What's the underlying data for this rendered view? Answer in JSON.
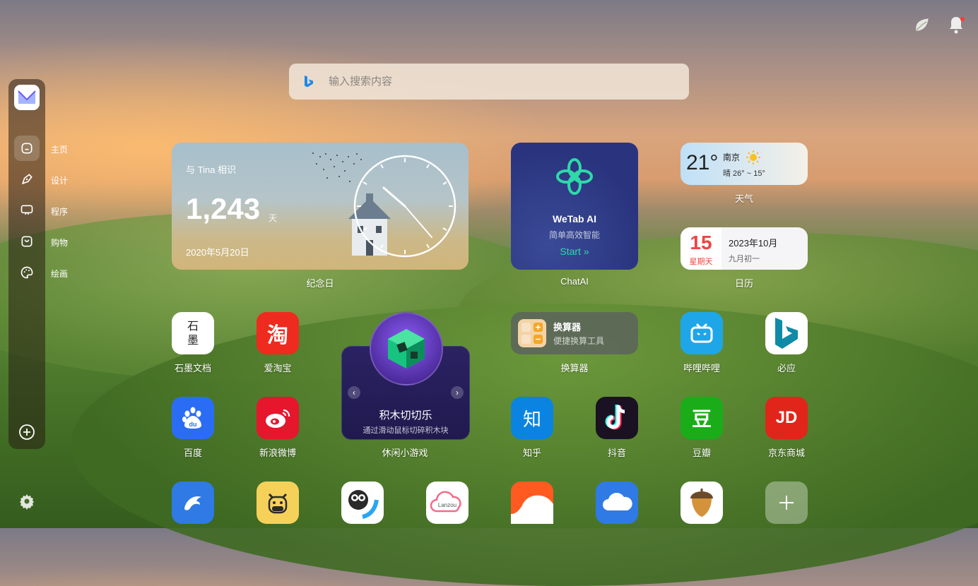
{
  "search": {
    "placeholder": "输入搜索内容"
  },
  "sidebar": {
    "items": [
      {
        "label": "主页",
        "icon": "home-icon"
      },
      {
        "label": "设计",
        "icon": "pen-icon"
      },
      {
        "label": "程序",
        "icon": "code-icon"
      },
      {
        "label": "购物",
        "icon": "bag-icon"
      },
      {
        "label": "绘画",
        "icon": "palette-icon"
      }
    ]
  },
  "widgets": {
    "anniversary": {
      "title": "与 Tina 相识",
      "count": "1,243",
      "unit": "天",
      "date": "2020年5月20日",
      "caption": "纪念日"
    },
    "chatai": {
      "title": "WeTab AI",
      "subtitle": "简单高效智能",
      "start": "Start »",
      "caption": "ChatAI"
    },
    "weather": {
      "temp": "21°",
      "city": "南京",
      "range": "晴 26° ~ 15°",
      "caption": "天气"
    },
    "calendar": {
      "day": "15",
      "weekday": "星期天",
      "year_month": "2023年10月",
      "lunar": "九月初一",
      "caption": "日历"
    },
    "converter": {
      "title": "换算器",
      "subtitle": "便捷换算工具",
      "caption": "换算器"
    },
    "game": {
      "title": "积木切切乐",
      "subtitle": "通过滑动鼠标切碎积木块",
      "caption": "休闲小游戏"
    }
  },
  "apps": {
    "shimo": {
      "label": "石墨文档",
      "glyph": "石墨"
    },
    "taobao": {
      "label": "爱淘宝",
      "glyph": "淘"
    },
    "bilibili": {
      "label": "哔哩哔哩"
    },
    "bing": {
      "label": "必应"
    },
    "baidu": {
      "label": "百度",
      "glyph": "du"
    },
    "weibo": {
      "label": "新浪微博"
    },
    "zhihu": {
      "label": "知乎",
      "glyph": "知"
    },
    "douyin": {
      "label": "抖音"
    },
    "douban": {
      "label": "豆瓣",
      "glyph": "豆"
    },
    "jd": {
      "label": "京东商城",
      "glyph": "JD"
    },
    "lanzou": {
      "glyph": "Lanzou"
    }
  },
  "colors": {
    "accent_green": "#2fd9a8",
    "calendar_red": "#ef4444",
    "taobao_red": "#ef2a1e",
    "baidu_blue": "#2a6df4",
    "zhihu_blue": "#0a84e0",
    "douban_green": "#1aad19",
    "jd_red": "#e1251b"
  }
}
